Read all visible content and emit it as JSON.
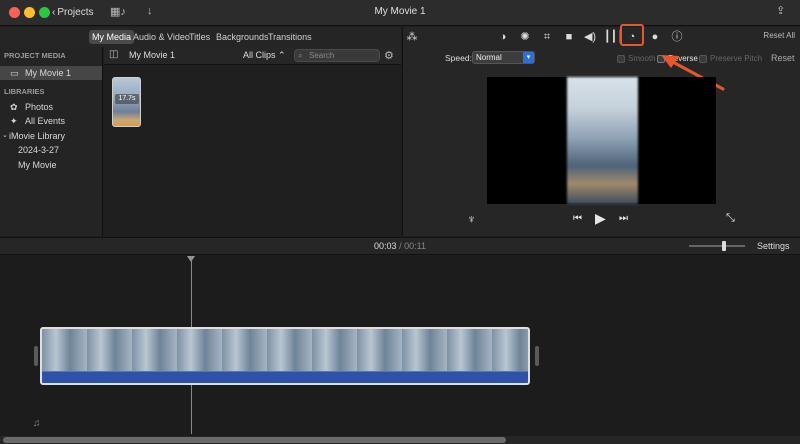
{
  "window": {
    "title": "My Movie 1",
    "back_label": "Projects"
  },
  "colors": {
    "accent_highlight": "#e8572a",
    "select_blue": "#2d6fd6",
    "audio_track": "#2d52a8"
  },
  "media_tabs": [
    "My Media",
    "Audio & Video",
    "Titles",
    "Backgrounds",
    "Transitions"
  ],
  "sidebar": {
    "project_header": "PROJECT MEDIA",
    "project_item": "My Movie 1",
    "libraries_header": "LIBRARIES",
    "items": [
      "Photos",
      "All Events",
      "iMovie Library",
      "2024-3-27",
      "My Movie"
    ]
  },
  "browser": {
    "title": "My Movie 1",
    "filter": "All Clips",
    "search_placeholder": "Search",
    "clip_duration": "17.7s"
  },
  "viewer": {
    "reset_all": "Reset All",
    "speed_label": "Speed:",
    "speed_value": "Normal",
    "smooth_label": "Smooth",
    "reverse_label": "Reverse",
    "preserve_pitch_label": "Preserve Pitch",
    "reset_label": "Reset"
  },
  "timeline": {
    "current_time": "00:03",
    "separator": "/",
    "total_time": "00:11",
    "settings_label": "Settings"
  }
}
